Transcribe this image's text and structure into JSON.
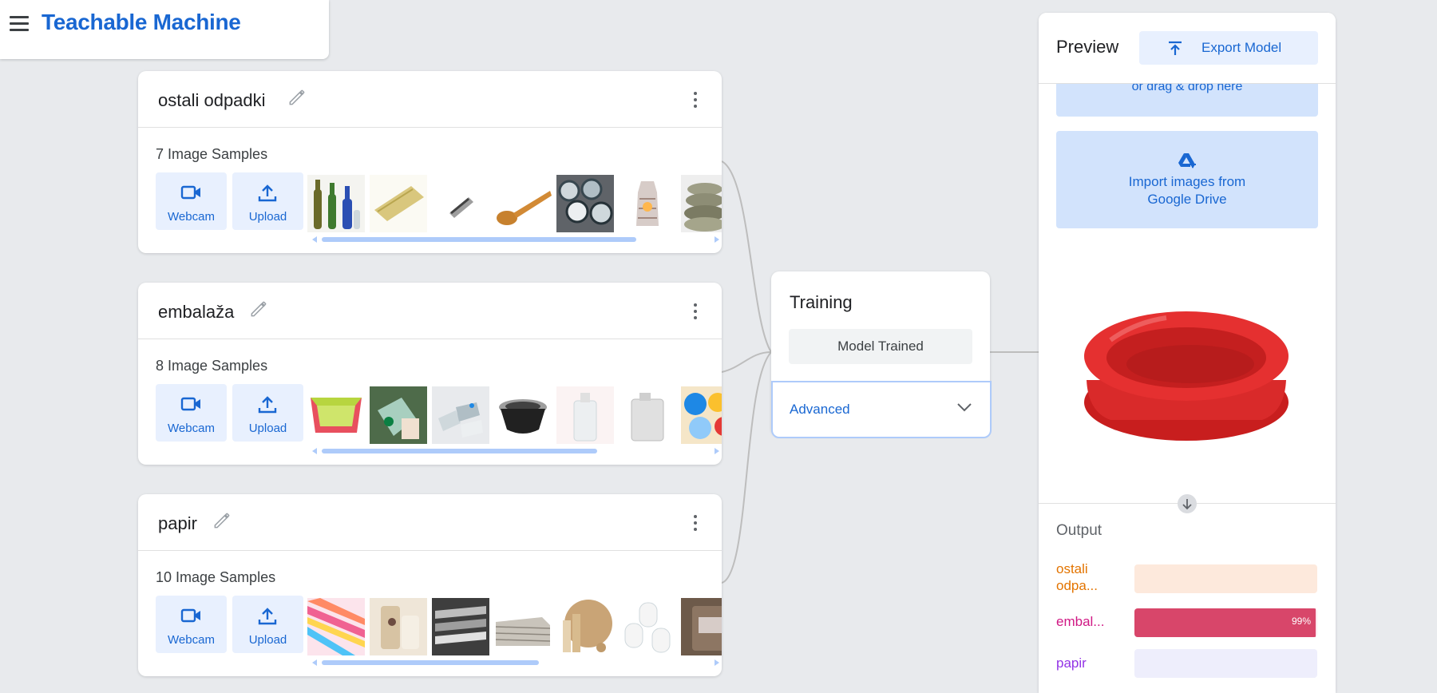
{
  "app": {
    "title": "Teachable Machine"
  },
  "classes": [
    {
      "name": "ostali odpadki",
      "count_label": "7 Image Samples",
      "webcam_label": "Webcam",
      "upload_label": "Upload",
      "scroll_fraction": 0.81
    },
    {
      "name": "embalaža",
      "count_label": "8 Image Samples",
      "webcam_label": "Webcam",
      "upload_label": "Upload",
      "scroll_fraction": 0.71
    },
    {
      "name": "papir",
      "count_label": "10 Image Samples",
      "webcam_label": "Webcam",
      "upload_label": "Upload",
      "scroll_fraction": 0.56
    }
  ],
  "training": {
    "title": "Training",
    "status_label": "Model Trained",
    "advanced_label": "Advanced"
  },
  "preview": {
    "title": "Preview",
    "export_label": "Export Model",
    "drop_hint": "or drag & drop here",
    "drive_line1": "Import images from",
    "drive_line2": "Google Drive",
    "output_title": "Output",
    "outputs": [
      {
        "label_line1": "ostali",
        "label_line2": "odpa...",
        "color": "#e37400",
        "bar_bg": "#fde9dc",
        "fill_color": "#e8710a",
        "value": 0.0,
        "pct_label": ""
      },
      {
        "label_line1": "embal...",
        "label_line2": "",
        "color": "#d01884",
        "bar_bg": "#fce8ef",
        "fill_color": "#d8466a",
        "value": 0.99,
        "pct_label": "99%"
      },
      {
        "label_line1": "papir",
        "label_line2": "",
        "color": "#9334e6",
        "bar_bg": "#eeeefc",
        "fill_color": "#8e7cc3",
        "value": 0.0,
        "pct_label": ""
      }
    ]
  },
  "colors": {
    "accent": "#1967d2",
    "accent_light": "#e8f0fe",
    "background": "#e8eaed"
  }
}
